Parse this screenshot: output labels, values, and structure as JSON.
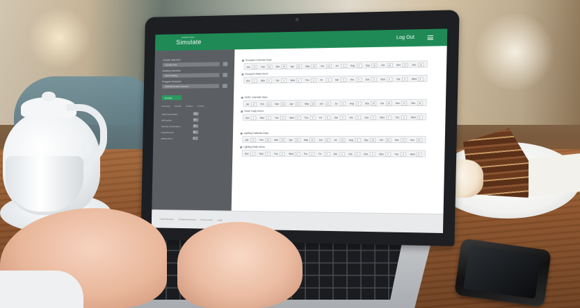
{
  "app": {
    "brand_small": "MINDRIVER",
    "brand": "Simulate",
    "logout_label": "Log Out",
    "accent_color": "#1f8a55"
  },
  "sidebar": {
    "label_climate": "Climate Selection",
    "select_climate": "Climate Zone",
    "label_building": "Building Selection",
    "select_building": "Office Building",
    "label_program": "Program Schedule",
    "select_program": "ASHRAE Default Schedule",
    "submit_label": "Simulate",
    "tabs": [
      "Summary",
      "Results",
      "Heating",
      "Cooling"
    ],
    "stats": [
      {
        "label": "Total Consumption",
        "value": "120"
      },
      {
        "label": "kWh/sq.ft/yr",
        "value": "43"
      },
      {
        "label": "Monthly Consumption",
        "value": "18"
      },
      {
        "label": "Peak Demand",
        "value": "22"
      },
      {
        "label": "kWh/sq.ft/mo",
        "value": "6"
      }
    ]
  },
  "main": {
    "back_icon": "chevron-left-icon",
    "sections": [
      {
        "title": "Occupied Calendar Days",
        "cells": [
          {
            "label": "Jan",
            "value": "17"
          },
          {
            "label": "Feb",
            "value": "19"
          },
          {
            "label": "Mar",
            "value": "16"
          },
          {
            "label": "Apr",
            "value": "21"
          },
          {
            "label": "May",
            "value": "10"
          },
          {
            "label": "Jun",
            "value": "13"
          },
          {
            "label": "Jul",
            "value": "6"
          },
          {
            "label": "Aug",
            "value": "5"
          },
          {
            "label": "Sep",
            "value": "20"
          },
          {
            "label": "Oct",
            "value": "22"
          },
          {
            "label": "Nov",
            "value": "17"
          },
          {
            "label": "Dec",
            "value": "15"
          }
        ]
      },
      {
        "title": "Occupied Daily Hours",
        "cells": [
          {
            "label": "Sun",
            "value": "0"
          },
          {
            "label": "Mon",
            "value": "4"
          },
          {
            "label": "Tue",
            "value": "4"
          },
          {
            "label": "Wed",
            "value": "6"
          },
          {
            "label": "Thu",
            "value": "6"
          },
          {
            "label": "Fri",
            "value": "6"
          },
          {
            "label": "Sat",
            "value": "0"
          },
          {
            "label": "Hol",
            "value": "4"
          },
          {
            "label": "Sun",
            "value": "0"
          },
          {
            "label": "Mon",
            "value": "4"
          },
          {
            "label": "Tue",
            "value": "6"
          },
          {
            "label": "Wed",
            "value": "8"
          }
        ]
      },
      {
        "title": "HVAC Calendar Days",
        "cells": [
          {
            "label": "Jan",
            "value": "17"
          },
          {
            "label": "Feb",
            "value": "16"
          },
          {
            "label": "Mar",
            "value": "16"
          },
          {
            "label": "Apr",
            "value": "17"
          },
          {
            "label": "May",
            "value": "20"
          },
          {
            "label": "Jun",
            "value": "13"
          },
          {
            "label": "Jul",
            "value": "6"
          },
          {
            "label": "Aug",
            "value": "5"
          },
          {
            "label": "Sep",
            "value": "20"
          },
          {
            "label": "Oct",
            "value": "22"
          },
          {
            "label": "Nov",
            "value": "17"
          },
          {
            "label": "Dec",
            "value": "15"
          }
        ]
      },
      {
        "title": "HVAC Daily Hours",
        "cells": [
          {
            "label": "Sun",
            "value": "4"
          },
          {
            "label": "Mon",
            "value": "4"
          },
          {
            "label": "Tue",
            "value": "6"
          },
          {
            "label": "Wed",
            "value": "6"
          },
          {
            "label": "Thu",
            "value": "6"
          },
          {
            "label": "Fri",
            "value": "6"
          },
          {
            "label": "Sat",
            "value": "4"
          },
          {
            "label": "Hol",
            "value": "4"
          },
          {
            "label": "Sun",
            "value": "4"
          },
          {
            "label": "Mon",
            "value": "4"
          },
          {
            "label": "Tue",
            "value": "6"
          },
          {
            "label": "Wed",
            "value": "8"
          }
        ]
      },
      {
        "title": "Lighting Calendar Days",
        "cells": [
          {
            "label": "Jan",
            "value": "17"
          },
          {
            "label": "Feb",
            "value": "19"
          },
          {
            "label": "Mar",
            "value": "16"
          },
          {
            "label": "Apr",
            "value": "21"
          },
          {
            "label": "May",
            "value": "22"
          },
          {
            "label": "Jun",
            "value": "13"
          },
          {
            "label": "Jul",
            "value": "12"
          },
          {
            "label": "Aug",
            "value": "5"
          },
          {
            "label": "Sep",
            "value": "20"
          },
          {
            "label": "Oct",
            "value": "22"
          },
          {
            "label": "Nov",
            "value": "17"
          },
          {
            "label": "Dec",
            "value": "15"
          }
        ]
      },
      {
        "title": "Lighting Daily Hours",
        "cells": [
          {
            "label": "Sun",
            "value": "4"
          },
          {
            "label": "Mon",
            "value": "4"
          },
          {
            "label": "Tue",
            "value": "6"
          },
          {
            "label": "Wed",
            "value": "6"
          },
          {
            "label": "Thu",
            "value": "6"
          },
          {
            "label": "Fri",
            "value": "6"
          },
          {
            "label": "Sat",
            "value": "4"
          },
          {
            "label": "Hol",
            "value": "4"
          },
          {
            "label": "Sun",
            "value": "4"
          },
          {
            "label": "Mon",
            "value": "4"
          },
          {
            "label": "Tue",
            "value": "6"
          },
          {
            "label": "Wed",
            "value": "8"
          }
        ]
      }
    ]
  },
  "footer": {
    "copyright": "©2015 Mindriver",
    "links": [
      "All Rights Reserved",
      "Privacy Policy",
      "Legal"
    ]
  }
}
